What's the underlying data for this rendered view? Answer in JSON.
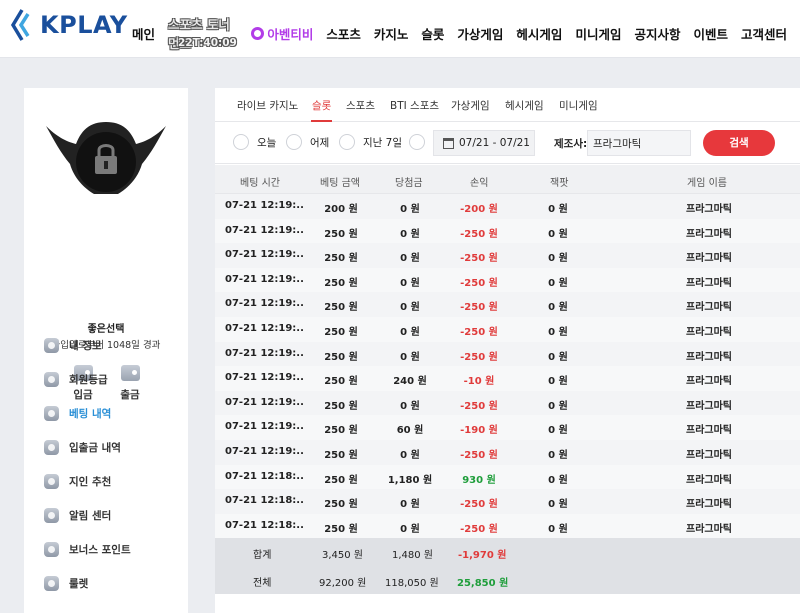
{
  "header": {
    "logo_text": "KPLAY",
    "nav": [
      "메인",
      "카지노",
      "슬롯",
      "가상게임",
      "헤시게임",
      "미니게임",
      "공지사항",
      "이벤트",
      "고객센터"
    ],
    "sports_tournament": "스포츠 토너먼트",
    "sports_timer": "22T:40:09",
    "afreeca": "아벤티비",
    "sports": "스포츠",
    "colors": {
      "logo": "#1a4f9c",
      "afreeca": "#b23ce8"
    }
  },
  "sidebar": {
    "user_name": "좋은선택",
    "user_days": "가입일로부터 1048일 경과",
    "deposit": "입금",
    "withdraw": "출금",
    "menu": [
      {
        "label": "내 정보",
        "icon": "user-icon"
      },
      {
        "label": "회원등급",
        "icon": "badge-icon"
      },
      {
        "label": "베팅 내역",
        "icon": "list-icon",
        "active": true
      },
      {
        "label": "입출금 내역",
        "icon": "wallet-icon"
      },
      {
        "label": "지인 추천",
        "icon": "people-icon"
      },
      {
        "label": "알림 센터",
        "icon": "chat-icon"
      },
      {
        "label": "보너스 포인트",
        "icon": "gift-icon"
      },
      {
        "label": "룰렛",
        "icon": "roulette-icon"
      }
    ],
    "active_color": "#2a8fd6"
  },
  "tabs": [
    "라이브 카지노",
    "슬롯",
    "스포츠",
    "BTI 스포츠",
    "가상게임",
    "헤시게임",
    "미니게임"
  ],
  "active_tab": "슬롯",
  "filters": {
    "today": "오늘",
    "yesterday": "어제",
    "last7": "지난 7일",
    "date_range": "07/21 - 07/21",
    "maker_label": "제조사:",
    "maker_value": "프라그마틱",
    "search": "검색"
  },
  "table": {
    "headers": [
      "베팅 시간",
      "베팅 금액",
      "당첨금",
      "손익",
      "잭팟",
      "게임 이름"
    ],
    "rows": [
      [
        "07-21 12:19:...",
        "200 원",
        "0 원",
        "-200 원",
        "0 원",
        "프라그마틱"
      ],
      [
        "07-21 12:19:...",
        "250 원",
        "0 원",
        "-250 원",
        "0 원",
        "프라그마틱"
      ],
      [
        "07-21 12:19:...",
        "250 원",
        "0 원",
        "-250 원",
        "0 원",
        "프라그마틱"
      ],
      [
        "07-21 12:19:...",
        "250 원",
        "0 원",
        "-250 원",
        "0 원",
        "프라그마틱"
      ],
      [
        "07-21 12:19:...",
        "250 원",
        "0 원",
        "-250 원",
        "0 원",
        "프라그마틱"
      ],
      [
        "07-21 12:19:...",
        "250 원",
        "0 원",
        "-250 원",
        "0 원",
        "프라그마틱"
      ],
      [
        "07-21 12:19:...",
        "250 원",
        "0 원",
        "-250 원",
        "0 원",
        "프라그마틱"
      ],
      [
        "07-21 12:19:...",
        "250 원",
        "240 원",
        "-10 원",
        "0 원",
        "프라그마틱"
      ],
      [
        "07-21 12:19:...",
        "250 원",
        "0 원",
        "-250 원",
        "0 원",
        "프라그마틱"
      ],
      [
        "07-21 12:19:...",
        "250 원",
        "60 원",
        "-190 원",
        "0 원",
        "프라그마틱"
      ],
      [
        "07-21 12:19:...",
        "250 원",
        "0 원",
        "-250 원",
        "0 원",
        "프라그마틱"
      ],
      [
        "07-21 12:18:...",
        "250 원",
        "1,180 원",
        "930 원",
        "0 원",
        "프라그마틱"
      ],
      [
        "07-21 12:18:...",
        "250 원",
        "0 원",
        "-250 원",
        "0 원",
        "프라그마틱"
      ],
      [
        "07-21 12:18:...",
        "250 원",
        "0 원",
        "-250 원",
        "0 원",
        "프라그마틱"
      ]
    ],
    "subtotal": {
      "label": "합계",
      "bet": "3,450 원",
      "win": "1,480 원",
      "pl": "-1,970 원"
    },
    "total": {
      "label": "전체",
      "bet": "92,200 원",
      "win": "118,050 원",
      "pl": "25,850 원"
    },
    "colors": {
      "loss": "#e03b3b",
      "gain": "#1f9e3b"
    }
  }
}
